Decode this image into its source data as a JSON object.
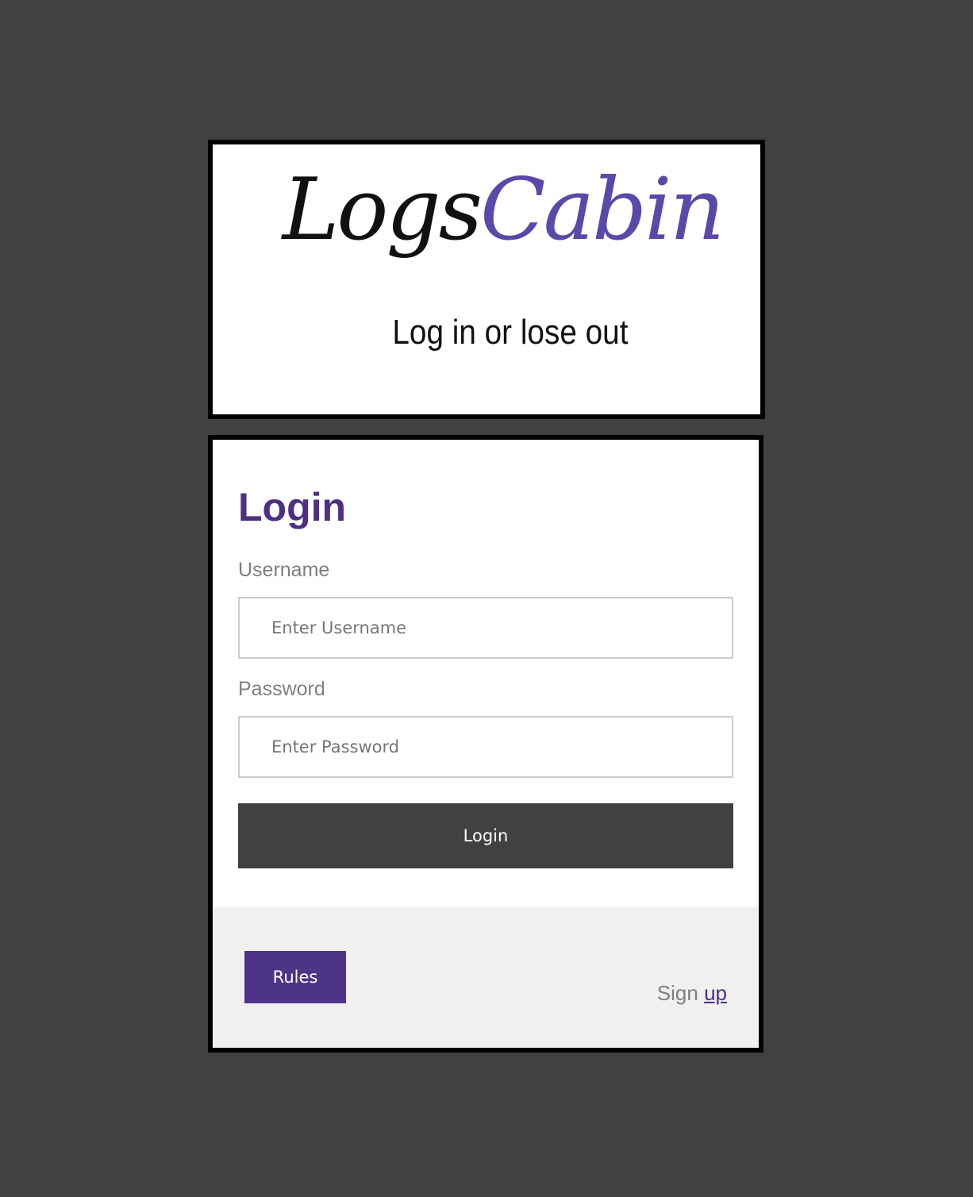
{
  "logo": {
    "title_part1": "Logs",
    "title_part2": "Cabin",
    "tagline": "Log in or lose out"
  },
  "login_form": {
    "heading": "Login",
    "username_label": "Username",
    "username_placeholder": "Enter Username",
    "username_value": "",
    "password_label": "Password",
    "password_placeholder": "Enter Password",
    "password_value": "",
    "submit_label": "Login"
  },
  "footer": {
    "rules_label": "Rules",
    "signup_prefix": "Sign",
    "signup_link": "up"
  },
  "colors": {
    "background": "#404241",
    "brand_purple": "#4e2f84",
    "rules_button": "#4e3486",
    "logo_accent": "#5b48a8",
    "login_button": "#404241",
    "footer_bg": "#f0f0f0"
  }
}
